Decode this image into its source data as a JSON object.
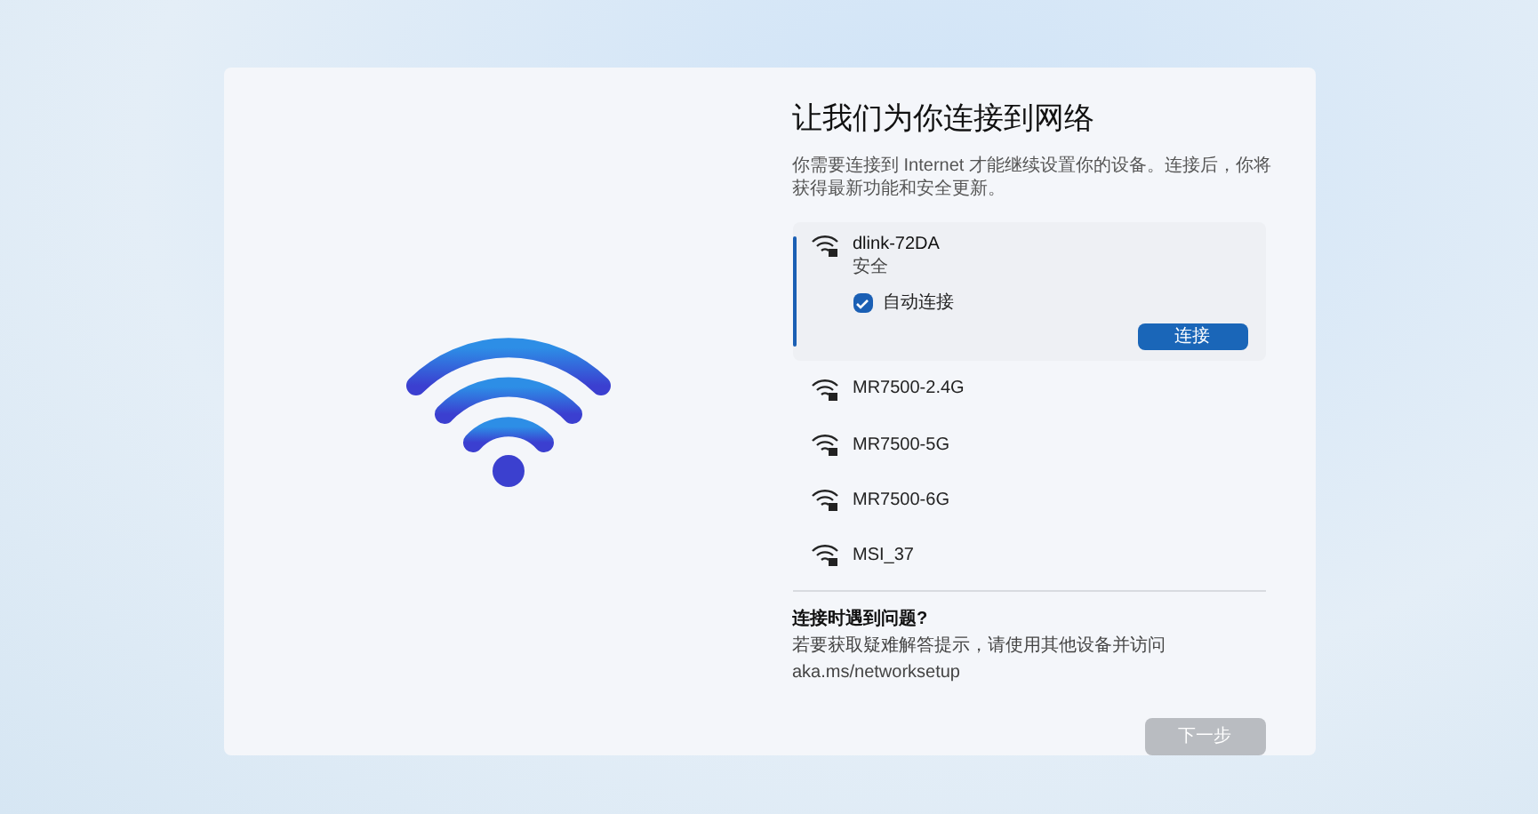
{
  "title": "让我们为你连接到网络",
  "description": "你需要连接到 Internet 才能继续设置你的设备。连接后，你将获得最新功能和安全更新。",
  "networks": [
    {
      "name": "dlink-72DA",
      "selected": true,
      "status": "安全",
      "auto_connect": {
        "label": "自动连接",
        "checked": true
      },
      "connect_button": "连接"
    },
    {
      "name": "MR7500-2.4G",
      "selected": false
    },
    {
      "name": "MR7500-5G",
      "selected": false
    },
    {
      "name": "MR7500-6G",
      "selected": false
    },
    {
      "name": "MSI_37",
      "selected": false
    }
  ],
  "help": {
    "title": "连接时遇到问题?",
    "text": "若要获取疑难解答提示，请使用其他设备并访问 aka.ms/networksetup"
  },
  "next_button": {
    "label": "下一步",
    "disabled": true
  }
}
